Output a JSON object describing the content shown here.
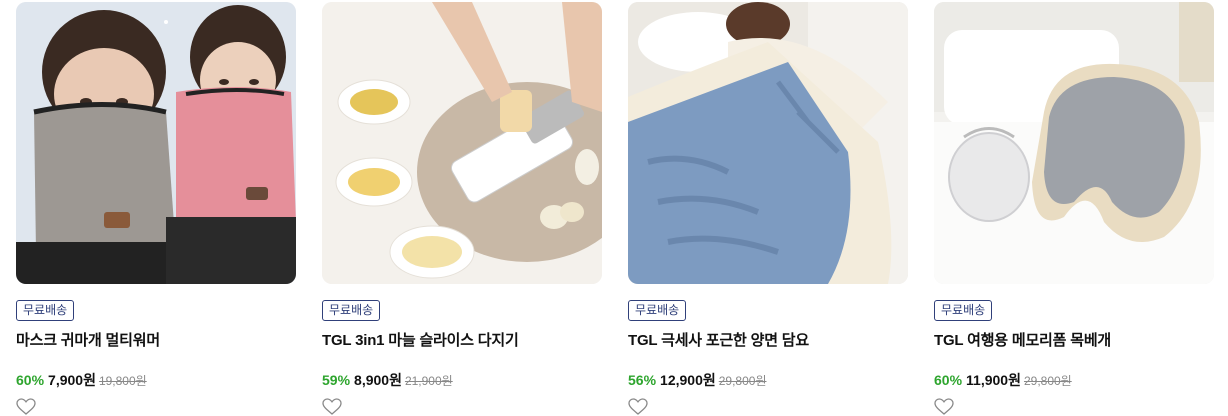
{
  "products": [
    {
      "badge": "무료배송",
      "title": "마스크 귀마개 멀티워머",
      "discount": "60%",
      "price": "7,900원",
      "original_price": "19,800원"
    },
    {
      "badge": "무료배송",
      "title": "TGL 3in1 마늘 슬라이스 다지기",
      "discount": "59%",
      "price": "8,900원",
      "original_price": "21,900원"
    },
    {
      "badge": "무료배송",
      "title": "TGL 극세사 포근한 양면 담요",
      "discount": "56%",
      "price": "12,900원",
      "original_price": "29,800원"
    },
    {
      "badge": "무료배송",
      "title": "TGL 여행용 메모리폼 목베개",
      "discount": "60%",
      "price": "11,900원",
      "original_price": "29,800원"
    }
  ],
  "colors": {
    "discount": "#2ea52e",
    "badge_border": "#30407a",
    "strike": "#888888"
  },
  "icons": {
    "wishlist": "heart-outline-icon"
  }
}
